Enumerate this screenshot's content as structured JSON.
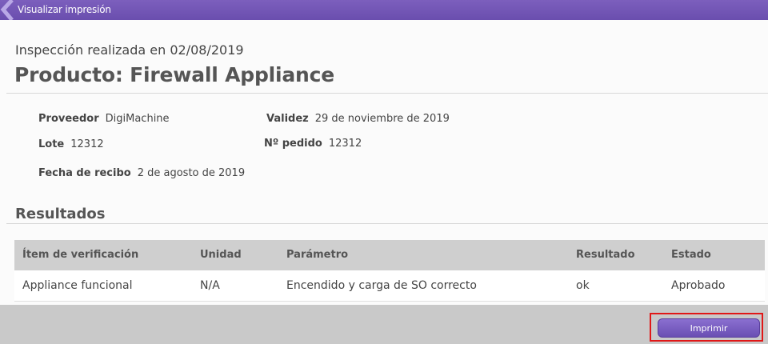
{
  "window": {
    "title": "Visualizar impresión"
  },
  "report": {
    "subtitle": "Inspección realizada en 02/08/2019",
    "title": "Producto: Firewall Appliance"
  },
  "details": {
    "supplier_label": "Proveedor",
    "supplier_value": "DigiMachine",
    "validity_label": "Validez",
    "validity_value": "29 de noviembre de 2019",
    "lot_label": "Lote",
    "lot_value": "12312",
    "order_label": "Nº pedido",
    "order_value": "12312",
    "received_label": "Fecha de recibo",
    "received_value": "2 de agosto de 2019"
  },
  "results": {
    "section_title": "Resultados",
    "columns": [
      "Ítem de verificación",
      "Unidad",
      "Parámetro",
      "Resultado",
      "Estado"
    ],
    "rows": [
      [
        "Appliance funcional",
        "N/A",
        "Encendido y carga de SO correcto",
        "ok",
        "Aprobado"
      ]
    ]
  },
  "footer": {
    "print_label": "Imprimir"
  },
  "colors": {
    "accent": "#6a4eae",
    "highlight": "#e01818"
  }
}
